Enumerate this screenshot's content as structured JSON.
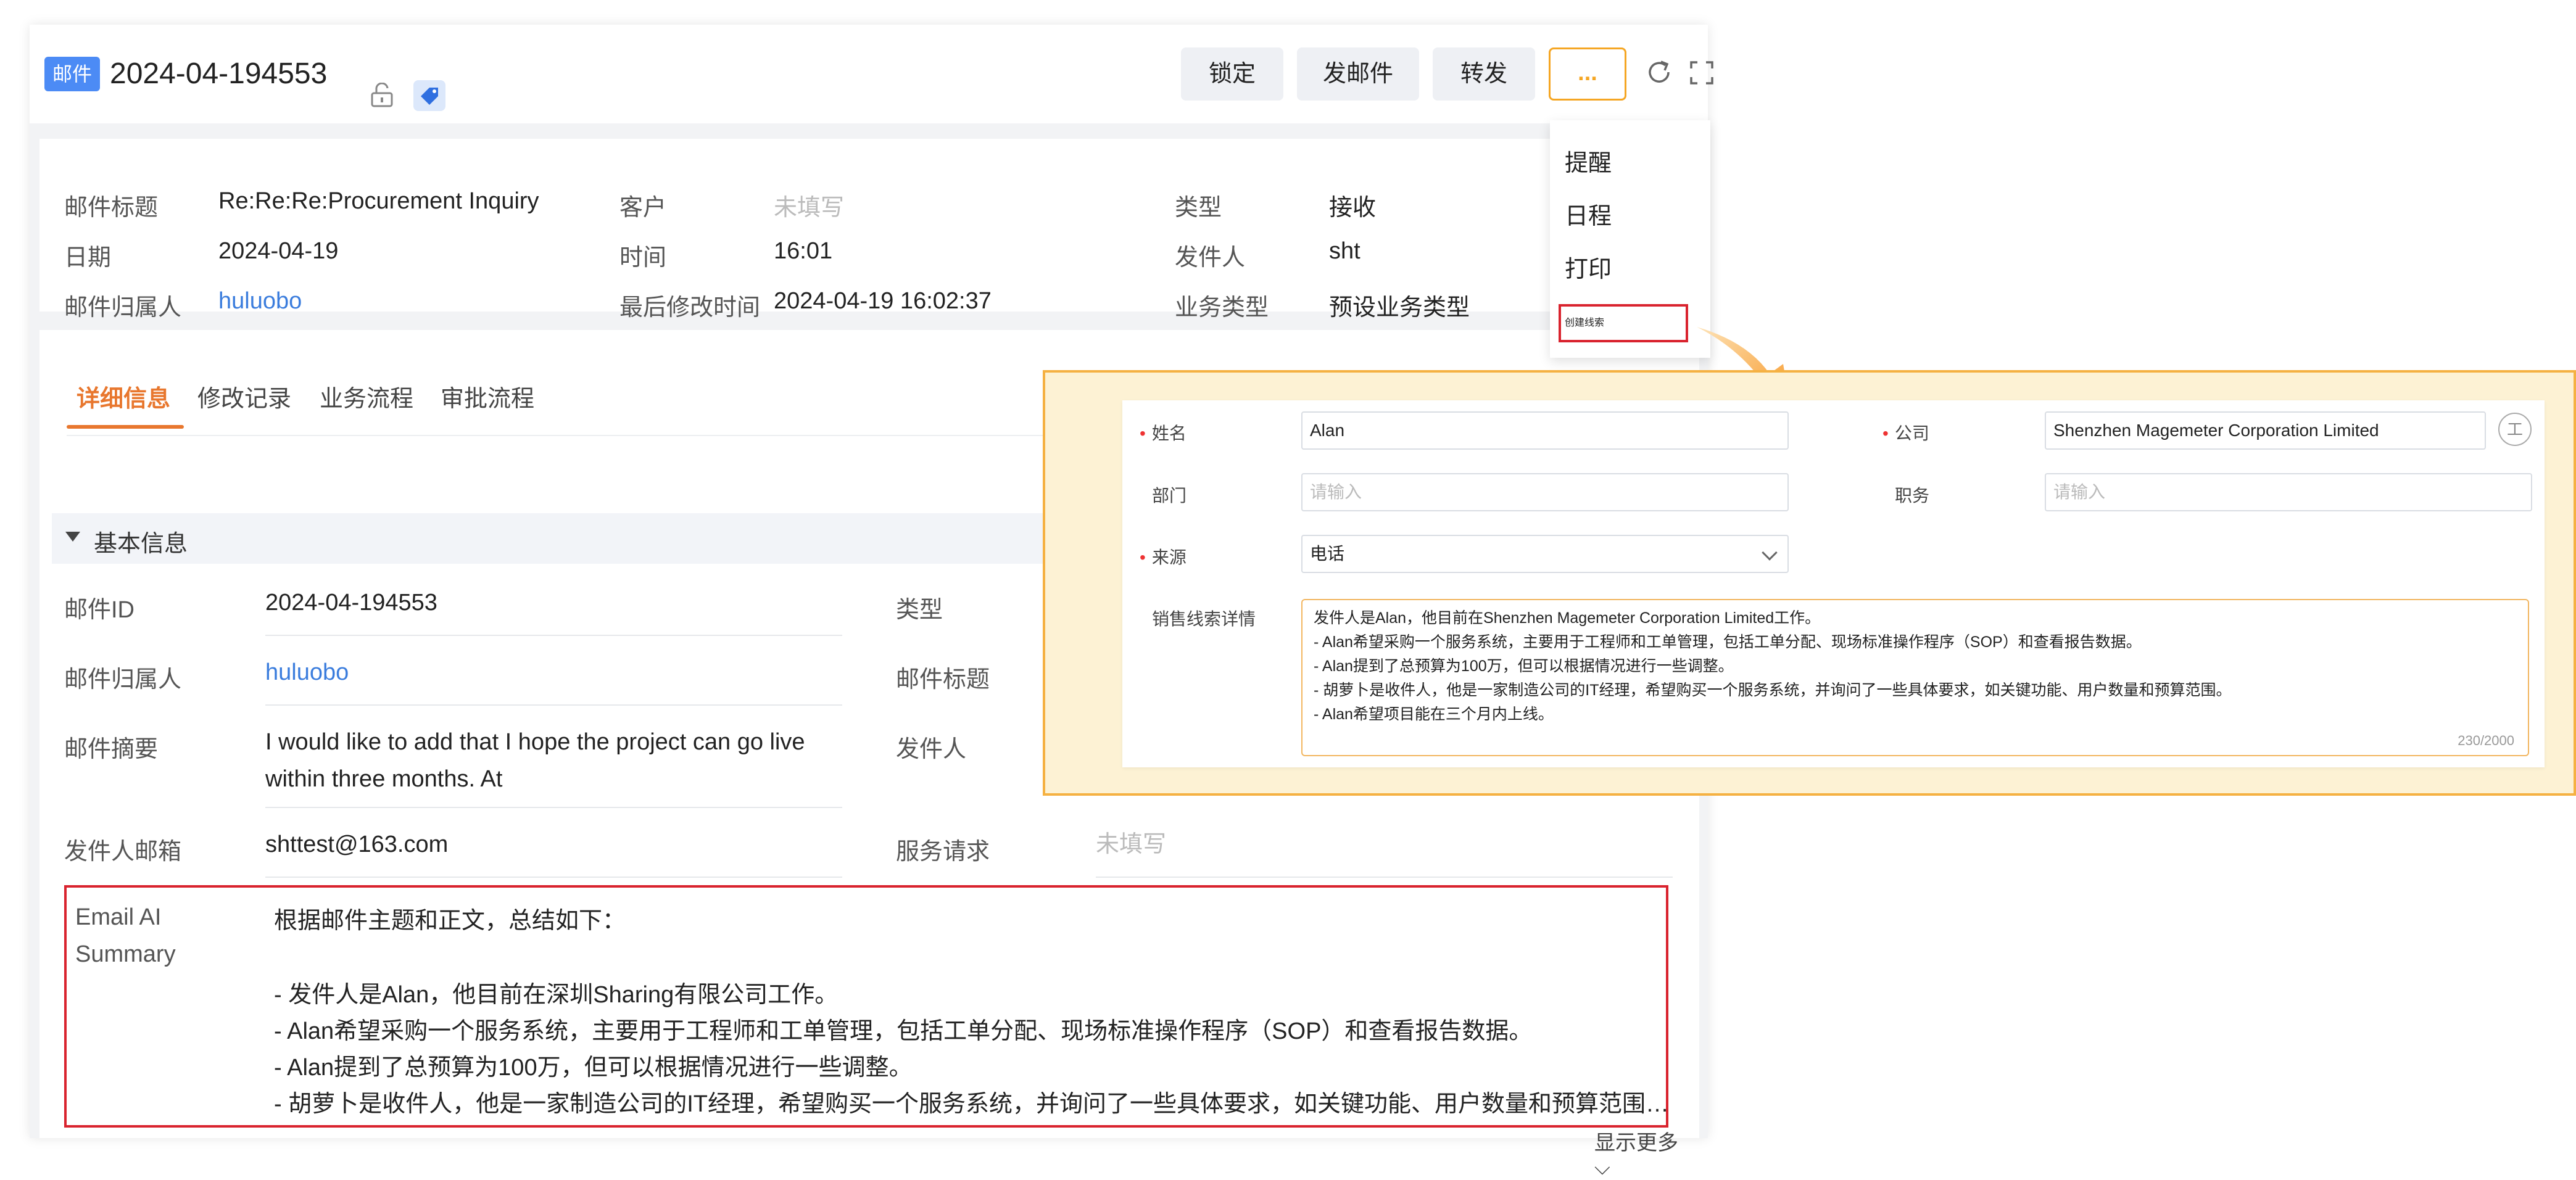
{
  "header": {
    "badge": "邮件",
    "title": "2024-04-194553",
    "buttons": {
      "lock": "锁定",
      "send_email": "发邮件",
      "forward": "转发",
      "more": "..."
    }
  },
  "summary": {
    "row1": {
      "label1": "邮件标题",
      "value1": "Re:Re:Re:Procurement Inquiry",
      "label2": "客户",
      "value2": "未填写",
      "label3": "类型",
      "value3": "接收"
    },
    "row2": {
      "label1": "日期",
      "value1": "2024-04-19",
      "label2": "时间",
      "value2": "16:01",
      "label3": "发件人",
      "value3": "sht"
    },
    "row3": {
      "label1": "邮件归属人",
      "value1": "huluobo",
      "label2": "最后修改时间",
      "value2": "2024-04-19 16:02:37",
      "label3": "业务类型",
      "value3": "预设业务类型"
    }
  },
  "tabs": [
    "详细信息",
    "修改记录",
    "业务流程",
    "审批流程"
  ],
  "section": {
    "title": "基本信息"
  },
  "fields": {
    "email_id": {
      "label": "邮件ID",
      "value": "2024-04-194553"
    },
    "owner": {
      "label": "邮件归属人",
      "value": "huluobo"
    },
    "abstract": {
      "label": "邮件摘要",
      "line1": "I would like to add that I hope the project can go live",
      "line2": "within three months. At"
    },
    "sender_email": {
      "label": "发件人邮箱",
      "value": "shttest@163.com"
    },
    "type": {
      "label": "类型"
    },
    "subject": {
      "label": "邮件标题"
    },
    "sender": {
      "label": "发件人"
    },
    "service_request": {
      "label": "服务请求",
      "value": "未填写"
    }
  },
  "ai_summary": {
    "label": "Email AI Summary",
    "intro": "根据邮件主题和正文，总结如下：",
    "lines": [
      "- 发件人是Alan，他目前在深圳Sharing有限公司工作。",
      "- Alan希望采购一个服务系统，主要用于工程师和工单管理，包括工单分配、现场标准操作程序（SOP）和查看报告数据。",
      "- Alan提到了总预算为100万，但可以根据情况进行一些调整。",
      "- 胡萝卜是收件人，他是一家制造公司的IT经理，希望购买一个服务系统，并询问了一些具体要求，如关键功能、用户数量和预算范围…"
    ],
    "show_more": "显示更多"
  },
  "menu": {
    "items": [
      "提醒",
      "日程",
      "打印",
      "创建线索"
    ]
  },
  "lead_form": {
    "name": {
      "label": "姓名",
      "value": "Alan"
    },
    "company": {
      "label": "公司",
      "value": "Shenzhen Magemeter Corporation Limited"
    },
    "department": {
      "label": "部门",
      "placeholder": "请输入"
    },
    "position": {
      "label": "职务",
      "placeholder": "请输入"
    },
    "source": {
      "label": "来源",
      "value": "电话"
    },
    "details": {
      "label": "销售线索详情",
      "lines": [
        "发件人是Alan，他目前在Shenzhen Magemeter Corporation Limited工作。",
        "- Alan希望采购一个服务系统，主要用于工程师和工单管理，包括工单分配、现场标准操作程序（SOP）和查看报告数据。",
        "- Alan提到了总预算为100万，但可以根据情况进行一些调整。",
        "- 胡萝卜是收件人，他是一家制造公司的IT经理，希望购买一个服务系统，并询问了一些具体要求，如关键功能、用户数量和预算范围。",
        "- Alan希望项目能在三个月内上线。"
      ],
      "counter": "230/2000"
    }
  },
  "colors": {
    "accent": "#e8772e",
    "link": "#3b7ddd",
    "highlight_red": "#d9232e",
    "callout_bg": "#fdf2d4",
    "callout_border": "#f5b142",
    "badge": "#4c8bf5"
  }
}
